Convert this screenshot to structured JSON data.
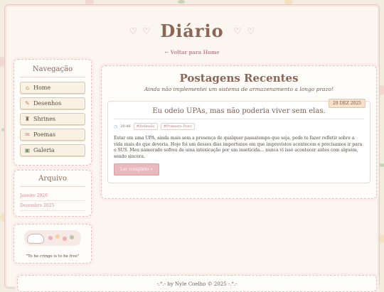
{
  "header": {
    "title": "Diário",
    "back_link": "← Voltar para Home",
    "heart_glyph": "♡"
  },
  "nav": {
    "title": "Navegação",
    "items": [
      {
        "label": "Home",
        "icon": "house-icon"
      },
      {
        "label": "Desenhos",
        "icon": "palette-icon"
      },
      {
        "label": "Shrines",
        "icon": "shrine-icon"
      },
      {
        "label": "Poemas",
        "icon": "scroll-icon"
      },
      {
        "label": "Galeria",
        "icon": "picture-icon"
      }
    ]
  },
  "archive": {
    "title": "Arquivo",
    "items": [
      "Janeiro 2026",
      "Dezembro 2025"
    ]
  },
  "sticker": {
    "caption": "\"To be cringe is to be free\""
  },
  "main": {
    "title": "Postagens Recentes",
    "subtitle": "Ainda não implementei um sistema de armazenamento a longo prazo!"
  },
  "post": {
    "date": "29 DEZ 2025",
    "title": "Eu odeio UPAs, mas não poderia viver sem elas.",
    "time": "20:46",
    "tags": [
      "#Reflexão",
      "#Primeiro Post!"
    ],
    "body": "Estar em uma UPA, ainda mais sem a presença de qualquer passatempo que seja, pode te fazer refletir sobre a vida mais do que deveria. Hoje foi um desses dias importunos em que imprevistos acontecem e precisamos ir para o SUS. Meu namorado sofreu de uma intoxicação por um inseticida... nunca vi isso acontecer antes com alguém, sendo sincera.",
    "read_more": "Ler completo »"
  },
  "footer": {
    "text": "-.°.- by Nyle Coelho © 2025 -.°.-"
  },
  "colors": {
    "accent": "#d99aa4",
    "title": "#8b6556",
    "background": "#f3ede1"
  }
}
